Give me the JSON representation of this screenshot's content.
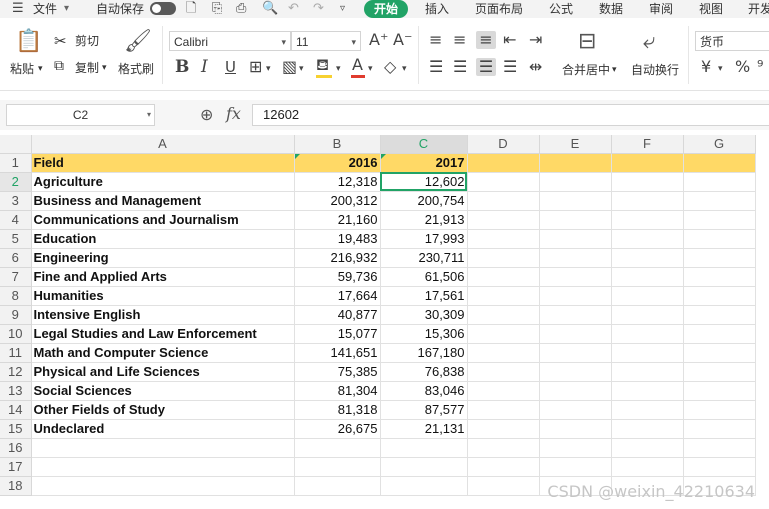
{
  "menu": {
    "file_label": "文件",
    "autosave_label": "自动保存",
    "tabs": [
      "开始",
      "插入",
      "页面布局",
      "公式",
      "数据",
      "审阅",
      "视图",
      "开发"
    ]
  },
  "ribbon": {
    "paste_label": "粘贴",
    "cut_label": "剪切",
    "copy_label": "复制",
    "format_painter_label": "格式刷",
    "font_name": "Calibri",
    "font_size": "11",
    "merge_center_label": "合并居中",
    "wrap_text_label": "自动换行",
    "number_format": "货币"
  },
  "formula_bar": {
    "cell_ref": "C2",
    "fx_label": "fx",
    "value": "12602"
  },
  "grid": {
    "columns": [
      "A",
      "B",
      "C",
      "D",
      "E",
      "F",
      "G"
    ],
    "rows": [
      {
        "n": "1",
        "a": "Field",
        "b": "2016",
        "c": "2017"
      },
      {
        "n": "2",
        "a": "Agriculture",
        "b": "12,318",
        "c": "12,602"
      },
      {
        "n": "3",
        "a": "Business and Management",
        "b": "200,312",
        "c": "200,754"
      },
      {
        "n": "4",
        "a": "Communications and Journalism",
        "b": "21,160",
        "c": "21,913"
      },
      {
        "n": "5",
        "a": "Education",
        "b": "19,483",
        "c": "17,993"
      },
      {
        "n": "6",
        "a": "Engineering",
        "b": "216,932",
        "c": "230,711"
      },
      {
        "n": "7",
        "a": "Fine and Applied Arts",
        "b": "59,736",
        "c": "61,506"
      },
      {
        "n": "8",
        "a": "Humanities",
        "b": "17,664",
        "c": "17,561"
      },
      {
        "n": "9",
        "a": "Intensive English",
        "b": "40,877",
        "c": "30,309"
      },
      {
        "n": "10",
        "a": "Legal Studies and Law Enforcement",
        "b": "15,077",
        "c": "15,306"
      },
      {
        "n": "11",
        "a": "Math and Computer Science",
        "b": "141,651",
        "c": "167,180"
      },
      {
        "n": "12",
        "a": "Physical and Life Sciences",
        "b": "75,385",
        "c": "76,838"
      },
      {
        "n": "13",
        "a": "Social Sciences",
        "b": "81,304",
        "c": "83,046"
      },
      {
        "n": "14",
        "a": "Other Fields of Study",
        "b": "81,318",
        "c": "87,577"
      },
      {
        "n": "15",
        "a": "Undeclared",
        "b": "26,675",
        "c": "21,131"
      }
    ],
    "empty_rows": [
      "16",
      "17",
      "18"
    ]
  },
  "watermark": "CSDN @weixin_42210634",
  "colors": {
    "accent": "#21a366",
    "header_fill": "#ffd966",
    "font_color_bar": "#e03b2e",
    "highlight_bar": "#f7d131"
  },
  "icons": {
    "menu": "hamburger-icon",
    "save": "save-icon",
    "print": "print-icon",
    "undo": "undo-icon",
    "redo": "redo-icon",
    "bold": "bold-icon",
    "italic": "italic-icon",
    "underline": "underline-icon",
    "zoom": "zoom-icon"
  }
}
